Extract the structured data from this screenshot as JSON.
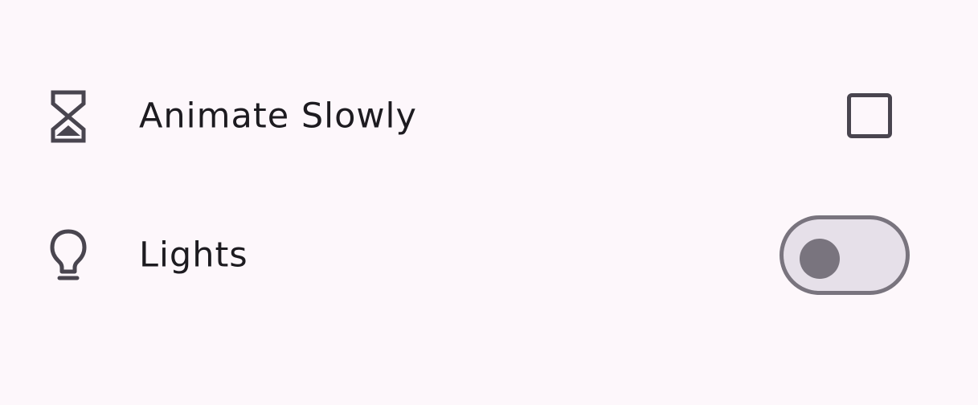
{
  "settings": {
    "items": [
      {
        "icon": "hourglass-icon",
        "label": "Animate Slowly",
        "control": "checkbox",
        "checked": false
      },
      {
        "icon": "lightbulb-icon",
        "label": "Lights",
        "control": "switch",
        "on": false
      }
    ]
  },
  "colors": {
    "background": "#fdf7fb",
    "text": "#1d1b20",
    "icon": "#49454f",
    "switch_outline": "#79747e",
    "switch_track": "#e6e0e9"
  }
}
